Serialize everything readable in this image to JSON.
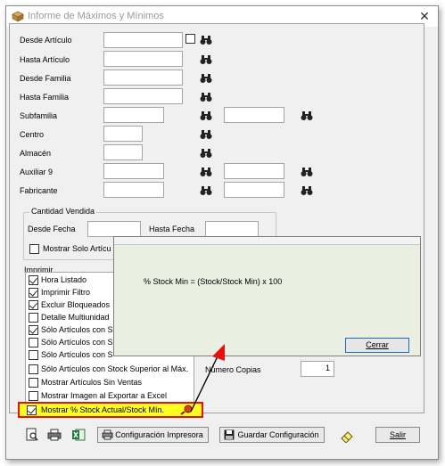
{
  "window": {
    "title": "Informe de Máximos y Mínimos",
    "close_glyph": "✕"
  },
  "filters": {
    "desde_articulo": {
      "label": "Desde Artículo",
      "value": ""
    },
    "hasta_articulo": {
      "label": "Hasta Artículo",
      "value": ""
    },
    "desde_familia": {
      "label": "Desde Familia",
      "value": ""
    },
    "hasta_familia": {
      "label": "Hasta Familia",
      "value": ""
    },
    "subfamilia": {
      "label": "Subfamilia",
      "value": "",
      "value2": ""
    },
    "centro": {
      "label": "Centro",
      "value": ""
    },
    "almacen": {
      "label": "Almacén",
      "value": ""
    },
    "auxiliar9": {
      "label": "Auxiliar 9",
      "value": "",
      "value2": ""
    },
    "fabricante": {
      "label": "Fabricante",
      "value": "",
      "value2": ""
    }
  },
  "cantidad_vendida": {
    "title": "Cantidad Vendida",
    "desde_fecha_label": "Desde Fecha",
    "hasta_fecha_label": "Hasta Fecha",
    "desde_fecha": "",
    "hasta_fecha": "",
    "mostrar_solo_label": "Mostrar Solo Artícu"
  },
  "imprimir": {
    "title": "Imprimir",
    "items": [
      {
        "label": "Hora Listado",
        "checked": true
      },
      {
        "label": "Imprimir Filtro",
        "checked": true
      },
      {
        "label": "Excluir Bloqueados",
        "checked": true
      },
      {
        "label": "Detalle Multiunidad",
        "checked": false
      },
      {
        "label": "Sólo Artículos con S",
        "checked": true
      },
      {
        "label": "Sólo Artículos con S",
        "checked": false
      },
      {
        "label": "Sólo Artículos con S",
        "checked": false
      },
      {
        "label": "Sólo Artículos con Stock Superior al Máx.",
        "checked": false
      },
      {
        "label": "Mostrar Artículos Sin Ventas",
        "checked": false
      },
      {
        "label": "Mostrar Imagen al Exportar a Excel",
        "checked": false
      },
      {
        "label": "Mostrar % Stock Actual/Stock Mín.",
        "checked": true
      }
    ]
  },
  "numero_copias": {
    "label": "Número Copias",
    "value": "1"
  },
  "popup": {
    "formula": "% Stock Min = (Stock/Stock Min) x 100",
    "close_label": "Cerrar"
  },
  "toolbar": {
    "config_impresora": "Configuración Impresora",
    "guardar_config": "Guardar Configuración",
    "salir": "Salir"
  },
  "colors": {
    "highlight_fill": "#ffff22",
    "highlight_border": "#e8100c",
    "arrow": "#000000"
  },
  "icons": [
    "package-icon",
    "binoculars-icon",
    "preview-icon",
    "printer-icon",
    "excel-icon",
    "eraser-icon",
    "floppy-icon",
    "printer-config-icon",
    "magnifier-icon"
  ]
}
